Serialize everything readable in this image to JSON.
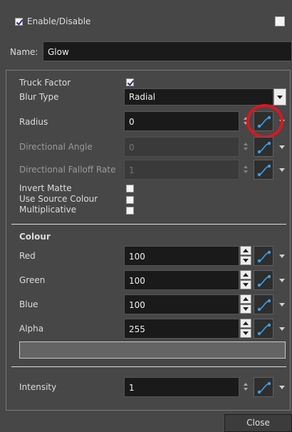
{
  "header": {
    "enable_label": "Enable/Disable",
    "enable_checked": true,
    "name_label": "Name:",
    "name_value": "Glow"
  },
  "properties": {
    "truck_factor": {
      "label": "Truck Factor",
      "checked": true
    },
    "blur_type": {
      "label": "Blur Type",
      "value": "Radial"
    },
    "radius": {
      "label": "Radius",
      "value": "0"
    },
    "directional_angle": {
      "label": "Directional Angle",
      "value": "0"
    },
    "directional_falloff_rate": {
      "label": "Directional Falloff Rate",
      "value": "1"
    },
    "invert_matte": {
      "label": "Invert Matte",
      "checked": false
    },
    "use_source_colour": {
      "label": "Use Source Colour",
      "checked": false
    },
    "multiplicative": {
      "label": "Multiplicative",
      "checked": false
    }
  },
  "colour": {
    "heading": "Colour",
    "red": {
      "label": "Red",
      "value": "100"
    },
    "green": {
      "label": "Green",
      "value": "100"
    },
    "blue": {
      "label": "Blue",
      "value": "100"
    },
    "alpha": {
      "label": "Alpha",
      "value": "255"
    },
    "swatch_color": "#646464"
  },
  "intensity": {
    "label": "Intensity",
    "value": "1"
  },
  "footer": {
    "close_label": "Close"
  },
  "icons": {
    "function_curve": "function-curve-icon",
    "highlight": "red-circle-annotation"
  },
  "colors": {
    "background": "#474747",
    "field_bg": "#1a1a1a",
    "annotation_red": "#e0141e"
  }
}
